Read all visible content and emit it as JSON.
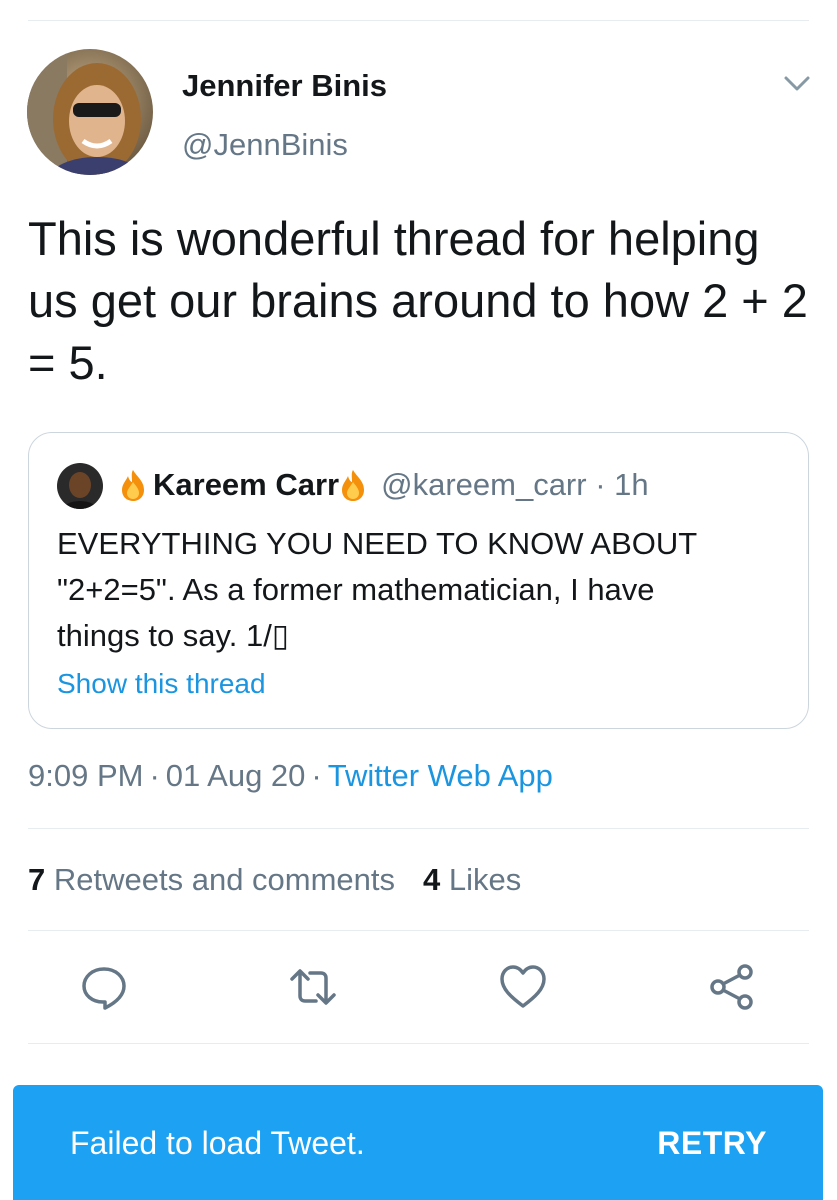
{
  "tweet": {
    "author_name": "Jennifer Binis",
    "author_handle": "@JennBinis",
    "text": "This is wonderful thread for helping us get our brains around to how 2 + 2 = 5.",
    "time": "9:09 PM",
    "separator": "·",
    "date": "01 Aug 20",
    "source": "Twitter Web App"
  },
  "quote": {
    "name": "Kareem Carr",
    "handle": "@kareem_carr · 1h",
    "text": "EVERYTHING YOU NEED TO KNOW ABOUT\n\"2+2=5\". As a former mathematician, I have\nthings to say.  1/▯",
    "show_thread": "Show this thread"
  },
  "stats": {
    "retweets_count": "7",
    "retweets_label": "Retweets and comments",
    "likes_count": "4",
    "likes_label": "Likes"
  },
  "actions": {
    "icons": [
      "reply-icon",
      "retweet-icon",
      "like-icon",
      "share-icon"
    ],
    "color": "#657786"
  },
  "snackbar": {
    "message": "Failed to load Tweet.",
    "action": "RETRY",
    "background": "#1da1f2"
  },
  "colors": {
    "link": "#1b95e0",
    "secondary_text": "#657786",
    "primary_text": "#14171a",
    "divider": "#e6ecf0"
  }
}
